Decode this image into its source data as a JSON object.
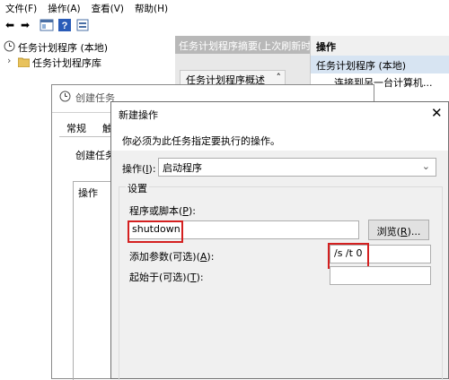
{
  "menu": [
    "文件(F)",
    "操作(A)",
    "查看(V)",
    "帮助(H)"
  ],
  "tree": {
    "root": "任务计划程序 (本地)",
    "child": "任务计划程序库"
  },
  "middle": {
    "header": "任务计划程序摘要(上次刷新时间",
    "summary_btn": "任务计划程序概述"
  },
  "actions_pane": {
    "title": "操作",
    "selected": "任务计划程序 (本地)",
    "item": "连接到另一台计算机..."
  },
  "create_task": {
    "title": "创建任务",
    "tab1": "常规",
    "tab2": "触",
    "desc_label": "创建任务",
    "list_header": "操作"
  },
  "dialog": {
    "title": "新建操作",
    "instruction": "你必须为此任务指定要执行的操作。",
    "action_label": "操作(",
    "action_key": "I",
    "action_suffix": "):",
    "action_value": "启动程序",
    "settings": "设置",
    "program_label": "程序或脚本(",
    "program_key": "P",
    "program_suffix": "):",
    "program_value": "shutdown",
    "browse_label": "浏览(",
    "browse_key": "R",
    "browse_suffix": ")...",
    "args_label": "添加参数(可选)(",
    "args_key": "A",
    "args_suffix": "):",
    "args_value": "/s /t 0",
    "start_label": "起始于(可选)(",
    "start_key": "T",
    "start_suffix": "):",
    "start_value": ""
  },
  "colors": {
    "highlight": "#d42020",
    "selection": "#d7e4f2",
    "dialog_bg": "#f0f0f0"
  }
}
